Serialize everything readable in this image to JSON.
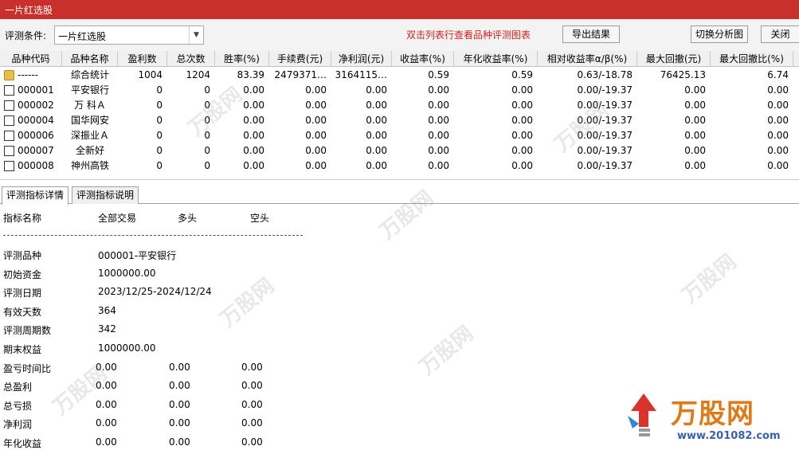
{
  "window": {
    "title": "一片红选股"
  },
  "toolbar": {
    "condition_label": "评测条件:",
    "condition_value": "一片红选股",
    "hint": "双击列表行查看品种评测图表",
    "export_label": "导出结果",
    "switch_label": "切换分析图",
    "close_label": "关闭"
  },
  "grid": {
    "columns": [
      "品种代码",
      "品种名称",
      "盈利数",
      "总次数",
      "胜率(%)",
      "手续费(元)",
      "净利润(元)",
      "收益率(%)",
      "年化收益率(%)",
      "相对收益率α/β(%)",
      "最大回撤(元)",
      "最大回撤比(%)"
    ],
    "rows": [
      {
        "code": "------",
        "name": "综合统计",
        "win": "1004",
        "total": "1204",
        "winrate": "83.39",
        "fee": "2479371…",
        "profit": "3164115…",
        "ret": "0.59",
        "annual": "0.59",
        "rel": "0.63/-18.78",
        "mdd": "76425.13",
        "mddr": "6.74"
      },
      {
        "code": "000001",
        "name": "平安银行",
        "win": "0",
        "total": "0",
        "winrate": "0.00",
        "fee": "0.00",
        "profit": "0.00",
        "ret": "0.00",
        "annual": "0.00",
        "rel": "0.00/-19.37",
        "mdd": "0.00",
        "mddr": "0.00"
      },
      {
        "code": "000002",
        "name": "万 科Ａ",
        "win": "0",
        "total": "0",
        "winrate": "0.00",
        "fee": "0.00",
        "profit": "0.00",
        "ret": "0.00",
        "annual": "0.00",
        "rel": "0.00/-19.37",
        "mdd": "0.00",
        "mddr": "0.00"
      },
      {
        "code": "000004",
        "name": "国华网安",
        "win": "0",
        "total": "0",
        "winrate": "0.00",
        "fee": "0.00",
        "profit": "0.00",
        "ret": "0.00",
        "annual": "0.00",
        "rel": "0.00/-19.37",
        "mdd": "0.00",
        "mddr": "0.00"
      },
      {
        "code": "000006",
        "name": "深振业Ａ",
        "win": "0",
        "total": "0",
        "winrate": "0.00",
        "fee": "0.00",
        "profit": "0.00",
        "ret": "0.00",
        "annual": "0.00",
        "rel": "0.00/-19.37",
        "mdd": "0.00",
        "mddr": "0.00"
      },
      {
        "code": "000007",
        "name": "全新好",
        "win": "0",
        "total": "0",
        "winrate": "0.00",
        "fee": "0.00",
        "profit": "0.00",
        "ret": "0.00",
        "annual": "0.00",
        "rel": "0.00/-19.37",
        "mdd": "0.00",
        "mddr": "0.00"
      },
      {
        "code": "000008",
        "name": "神州高铁",
        "win": "0",
        "total": "0",
        "winrate": "0.00",
        "fee": "0.00",
        "profit": "0.00",
        "ret": "0.00",
        "annual": "0.00",
        "rel": "0.00/-19.37",
        "mdd": "0.00",
        "mddr": "0.00"
      }
    ]
  },
  "tabs": [
    "评测指标详情",
    "评测指标说明"
  ],
  "detail": {
    "headers": [
      "指标名称",
      "全部交易",
      "多头",
      "空头"
    ],
    "rows": [
      {
        "label": "评测品种",
        "v1": "000001-平安银行",
        "v2": "",
        "v3": ""
      },
      {
        "label": "初始资金",
        "v1": "1000000.00",
        "v2": "",
        "v3": ""
      },
      {
        "label": "评测日期",
        "v1": "2023/12/25-2024/12/24",
        "v2": "",
        "v3": ""
      },
      {
        "label": "有效天数",
        "v1": "364",
        "v2": "",
        "v3": ""
      },
      {
        "label": "评测周期数",
        "v1": "342",
        "v2": "",
        "v3": ""
      },
      {
        "label": "期末权益",
        "v1": "1000000.00",
        "v2": "",
        "v3": ""
      },
      {
        "label": "盈亏时间比",
        "v1": "0.00",
        "v2": "0.00",
        "v3": "0.00"
      },
      {
        "label": "总盈利",
        "v1": "0.00",
        "v2": "0.00",
        "v3": "0.00"
      },
      {
        "label": "总亏损",
        "v1": "0.00",
        "v2": "0.00",
        "v3": "0.00"
      },
      {
        "label": "净利润",
        "v1": "0.00",
        "v2": "0.00",
        "v3": "0.00"
      },
      {
        "label": "年化收益",
        "v1": "0.00",
        "v2": "0.00",
        "v3": "0.00"
      }
    ]
  },
  "watermark": {
    "text": "万股网",
    "url": "www.201082.com"
  },
  "colors": {
    "titlebar": "#c9302c",
    "hint": "#d02020",
    "brand": "#e07a16",
    "url": "#3a60b0"
  }
}
